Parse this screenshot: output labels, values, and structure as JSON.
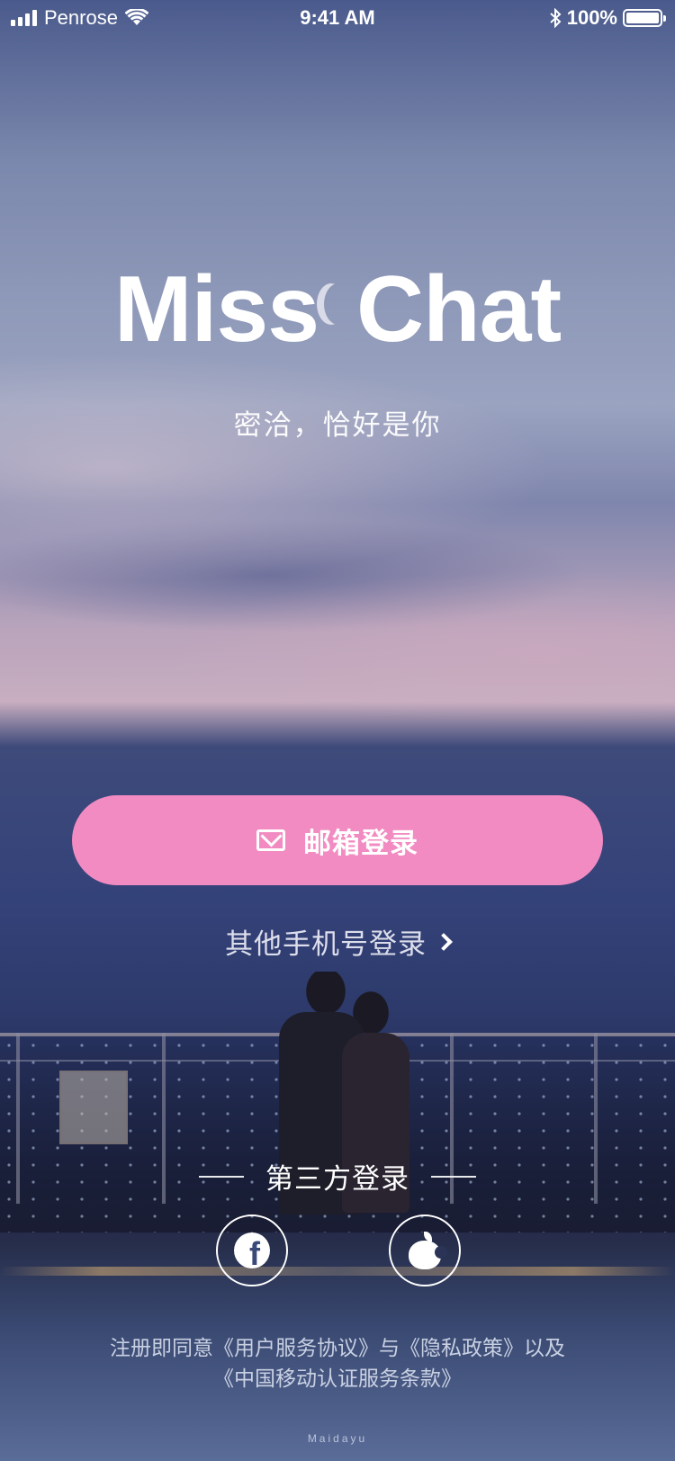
{
  "status_bar": {
    "carrier": "Penrose",
    "time": "9:41 AM",
    "battery": "100%",
    "icons": [
      "signal-icon",
      "wifi-icon",
      "bluetooth-icon",
      "battery-icon"
    ]
  },
  "brand": {
    "title_left": "Miss",
    "title_right": "Chat",
    "tagline": "密洽，恰好是你"
  },
  "login": {
    "email_label": "邮箱登录",
    "email_icon": "mail-icon",
    "phone_label": "其他手机号登录",
    "third_party_label": "第三方登录",
    "third_party": [
      {
        "name": "facebook",
        "icon": "facebook-icon"
      },
      {
        "name": "apple",
        "icon": "apple-icon"
      }
    ]
  },
  "terms": {
    "text": "注册即同意《用户服务协议》与《隐私政策》以及《中国移动认证服务条款》"
  },
  "watermark": "Maidayu",
  "colors": {
    "accent": "#f28bc1",
    "text": "#ffffff"
  }
}
